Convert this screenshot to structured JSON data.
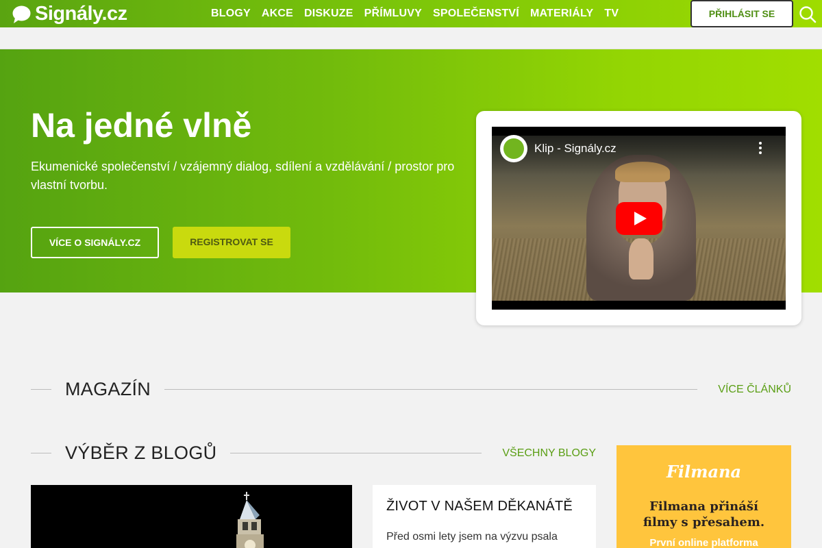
{
  "brand": {
    "name": "Signály.cz",
    "accent": "#5aa411",
    "accent_light": "#a1de00",
    "link_color": "#5a9e14"
  },
  "nav": {
    "items": [
      "BLOGY",
      "AKCE",
      "DISKUZE",
      "PŘÍMLUVY",
      "SPOLEČENSTVÍ",
      "MATERIÁLY",
      "TV"
    ],
    "login_label": "PŘIHLÁSIT SE",
    "search_icon": "search-icon"
  },
  "hero": {
    "title": "Na jedné vlně",
    "description": "Ekumenické společenství / vzájemný dialog, sdílení a vzdělávání / prostor pro vlastní tvorbu.",
    "more_button": "VÍCE O SIGNÁLY.CZ",
    "register_button": "REGISTROVAT SE"
  },
  "video": {
    "title": "Klip - Signály.cz",
    "menu_icon": "more-vertical-icon",
    "play_icon": "play-icon"
  },
  "magazine": {
    "title": "MAGAZÍN",
    "link": "VÍCE ČLÁNKŮ"
  },
  "blogs": {
    "title": "VÝBĚR Z BLOGŮ",
    "link": "VŠECHNY BLOGY",
    "featured": {
      "title": "ŽIVOT V NAŠEM DĚKANÁTĚ",
      "excerpt": "Před osmi lety jsem na výzvu psala"
    }
  },
  "ad": {
    "logo": "Filmana",
    "title_line1": "Filmana přináší",
    "title_line2": "filmy s přesahem.",
    "subtitle": "První online platforma"
  }
}
